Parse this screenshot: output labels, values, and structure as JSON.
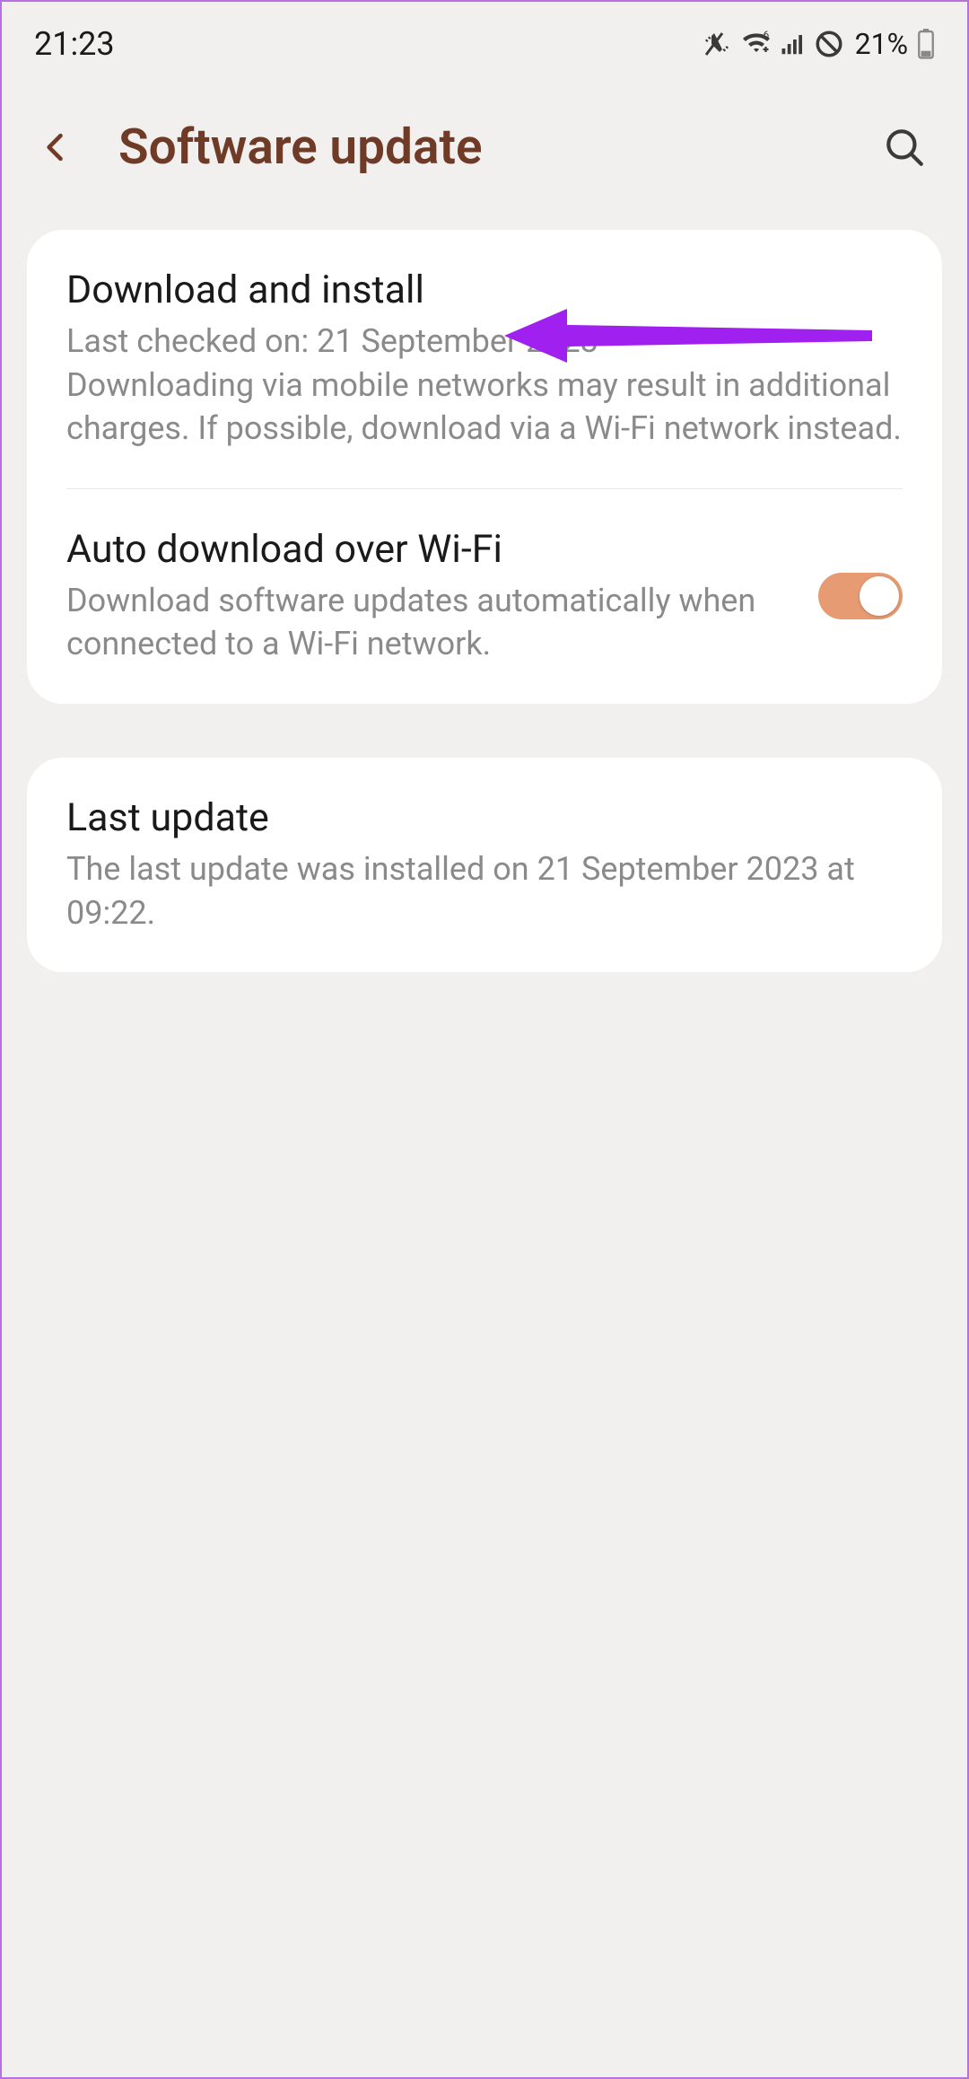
{
  "status_bar": {
    "time": "21:23",
    "battery_percent": "21%"
  },
  "header": {
    "title": "Software update"
  },
  "cards": [
    {
      "items": [
        {
          "title": "Download and install",
          "subtitle": "Last checked on: 21 September 2023\nDownloading via mobile networks may result in additional charges. If possible, download via a Wi-Fi network instead."
        },
        {
          "title": "Auto download over Wi-Fi",
          "subtitle": "Download software updates automatically when connected to a Wi-Fi network.",
          "toggle": true
        }
      ]
    },
    {
      "items": [
        {
          "title": "Last update",
          "subtitle": "The last update was installed on 21 September 2023 at 09:22."
        }
      ]
    }
  ]
}
